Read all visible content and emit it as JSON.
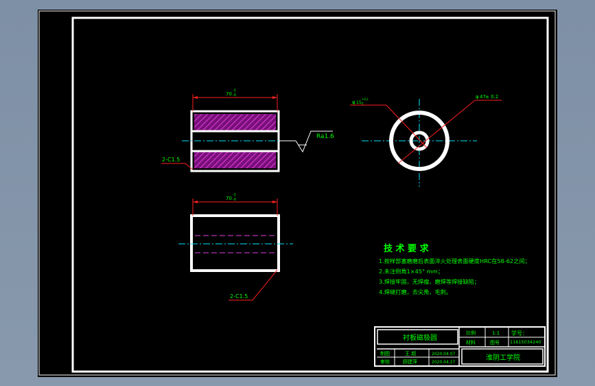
{
  "drawing": {
    "top_view": {
      "length_dim": "70",
      "tol_upper": "-1",
      "tol_lower": "-0",
      "chamfer_label": "2-C1.5",
      "roughness": "Ra1.6"
    },
    "side_view": {
      "outer_dia_prefix": "φ",
      "outer_dia_value": "47",
      "outer_dia_tol": "± 0.2",
      "inner_dia_prefix": "φ",
      "inner_dia_value": "15",
      "inner_tol_upper": "+0.2",
      "inner_tol_lower": "0"
    },
    "front_view": {
      "length_dim": "70",
      "tol_upper": "-1",
      "tol_lower": "-0",
      "chamfer_label": "2-C1.5"
    },
    "tech_requirements": {
      "title": "技 术 要 求",
      "items": [
        "1.按样部塞磨磨后表面淬火处理表面硬度HRC在58-62之间；",
        "2.未注倒角1×45° mm；",
        "3.焊接牢固，无焊瘤，磨焊等焊接缺陷；",
        "4.焊缝打磨，去尖角，毛刺。"
      ]
    },
    "title_block": {
      "part_name": "衬板磁极圆",
      "scale_label": "比例",
      "scale_value": "1:1",
      "material_label": "材料",
      "quantity_label": "图号",
      "drawing_no_label": "学号：",
      "drawing_no": "11615034240",
      "designer_label": "制图",
      "designer": "王 超",
      "designer_date": "2020.04.07",
      "reviewer_label": "审核",
      "reviewer": "顾建萍",
      "reviewer_date": "2020.04.27",
      "school": "淮阴工学院"
    },
    "colors": {
      "background": "#000000",
      "outline": "#ffffff",
      "dimension": "#ff2020",
      "text": "#00ff00",
      "centerline": "#00e5ff",
      "hatch": "#d020d0"
    }
  }
}
